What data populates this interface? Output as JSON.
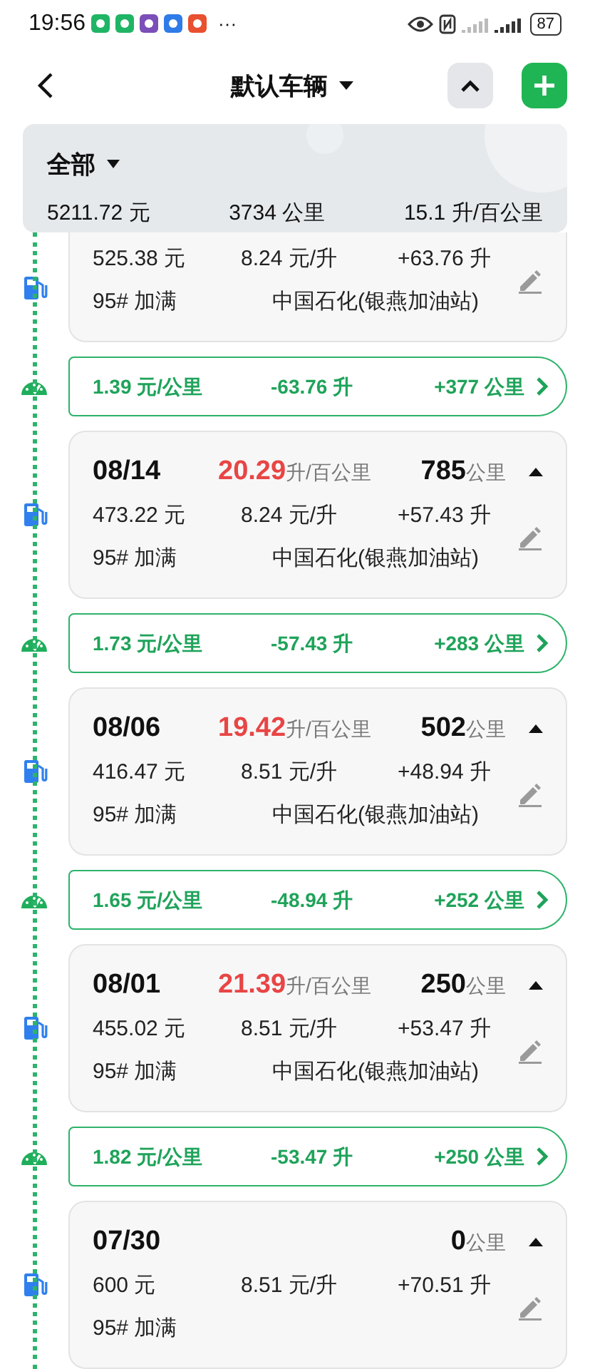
{
  "status_bar": {
    "time": "19:56",
    "more": "···",
    "battery": "87"
  },
  "header": {
    "title": "默认车辆"
  },
  "summary": {
    "filter": "全部",
    "total_cost": "5211.72 元",
    "total_distance": "3734 公里",
    "average_consumption": "15.1 升/百公里"
  },
  "entries": [
    {
      "kind": "refuel",
      "partial": true,
      "amount": "525.38 元",
      "price": "8.24 元/升",
      "volume": "+63.76 升",
      "fuel": "95# 加满",
      "station": "中国石化(银燕加油站)"
    },
    {
      "kind": "trip",
      "cost_per_km": "1.39 元/公里",
      "volume_change": "-63.76 升",
      "distance": "+377 公里"
    },
    {
      "kind": "refuel",
      "partial": false,
      "expanded": true,
      "date": "08/14",
      "consumption": "20.29",
      "consumption_unit": "升/百公里",
      "distance": "785",
      "distance_unit": "公里",
      "amount": "473.22 元",
      "price": "8.24 元/升",
      "volume": "+57.43 升",
      "fuel": "95# 加满",
      "station": "中国石化(银燕加油站)"
    },
    {
      "kind": "trip",
      "cost_per_km": "1.73 元/公里",
      "volume_change": "-57.43 升",
      "distance": "+283 公里"
    },
    {
      "kind": "refuel",
      "partial": false,
      "expanded": true,
      "date": "08/06",
      "consumption": "19.42",
      "consumption_unit": "升/百公里",
      "distance": "502",
      "distance_unit": "公里",
      "amount": "416.47 元",
      "price": "8.51 元/升",
      "volume": "+48.94 升",
      "fuel": "95# 加满",
      "station": "中国石化(银燕加油站)"
    },
    {
      "kind": "trip",
      "cost_per_km": "1.65 元/公里",
      "volume_change": "-48.94 升",
      "distance": "+252 公里"
    },
    {
      "kind": "refuel",
      "partial": false,
      "expanded": true,
      "date": "08/01",
      "consumption": "21.39",
      "consumption_unit": "升/百公里",
      "distance": "250",
      "distance_unit": "公里",
      "amount": "455.02 元",
      "price": "8.51 元/升",
      "volume": "+53.47 升",
      "fuel": "95# 加满",
      "station": "中国石化(银燕加油站)"
    },
    {
      "kind": "trip",
      "cost_per_km": "1.82 元/公里",
      "volume_change": "-53.47 升",
      "distance": "+250 公里"
    },
    {
      "kind": "refuel",
      "partial": false,
      "expanded": true,
      "date": "07/30",
      "distance": "0",
      "distance_unit": "公里",
      "amount": "600 元",
      "price": "8.51 元/升",
      "volume": "+70.51 升",
      "fuel": "95# 加满"
    }
  ]
}
